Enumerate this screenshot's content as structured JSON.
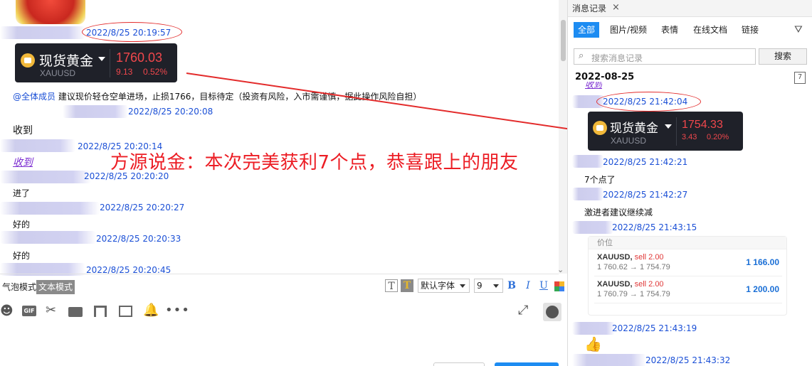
{
  "chat": {
    "messages": [
      {
        "time": "2022/8/25 20:19:57"
      },
      {
        "time": "2022/8/25 20:20:08",
        "text": "收到"
      },
      {
        "time": "2022/8/25 20:20:14",
        "text": "收到"
      },
      {
        "time": "2022/8/25 20:20:20",
        "text": "进了"
      },
      {
        "time": "2022/8/25 20:20:27",
        "text": "好的"
      },
      {
        "time": "2022/8/25 20:20:33",
        "text": "好的"
      },
      {
        "time": "2022/8/25 20:20:45"
      }
    ],
    "gold_card": {
      "name": "现货黄金",
      "symbol": "XAUUSD",
      "price": "1760.03",
      "change": "9.13",
      "change_pct": "0.52%"
    },
    "announcement": {
      "mention": "@全体成员",
      "text": " 建议现价轻仓空单进场，止损1766，目标待定（投资有风险，入市需谨慎，据此操作风险自担）"
    },
    "overlay_caption": "方源说金：本次完美获利7个点，恭喜跟上的朋友",
    "toolbar": {
      "mode_bubble": "气泡模式",
      "mode_text": "文本模式",
      "font_family": "默认字体",
      "font_size": "9"
    }
  },
  "history": {
    "tab_title": "消息记录",
    "filters": [
      "全部",
      "图片/视频",
      "表情",
      "在线文档",
      "链接"
    ],
    "search_placeholder": "搜索消息记录",
    "search_button": "搜索",
    "date": "2022-08-25",
    "partial_link": "收到",
    "times": [
      "2022/8/25 21:42:04",
      "2022/8/25 21:42:21",
      "2022/8/25 21:42:27",
      "2022/8/25 21:43:15",
      "2022/8/25 21:43:19",
      "2022/8/25 21:43:32"
    ],
    "texts": [
      "7个点了",
      "激进者建议继续减"
    ],
    "gold_card": {
      "name": "现货黄金",
      "symbol": "XAUUSD",
      "price": "1754.33",
      "change": "3.43",
      "change_pct": "0.20%"
    },
    "order_card": {
      "header": "价位",
      "rows": [
        {
          "symbol": "XAUUSD,",
          "side": "sell 2.00",
          "from": "1 760.62",
          "to": "1 754.79",
          "amount": "1 166.00"
        },
        {
          "symbol": "XAUUSD,",
          "side": "sell 2.00",
          "from": "1 760.79",
          "to": "1 754.79",
          "amount": "1 200.00"
        }
      ]
    }
  }
}
